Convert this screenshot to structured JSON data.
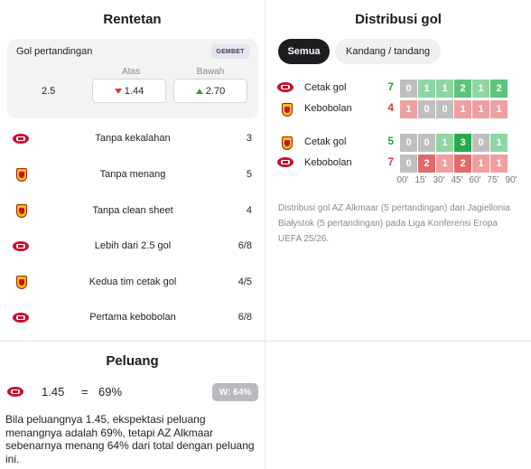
{
  "streaks": {
    "title": "Rentetan",
    "odds": {
      "label": "Gol pertandingan",
      "bookmaker": "GEMBET",
      "line": "2.5",
      "over_label": "Atas",
      "under_label": "Bawah",
      "over_value": "1.44",
      "under_value": "2.70",
      "over_trend": "down",
      "under_trend": "up"
    },
    "items": [
      {
        "team": "AZ Alkmaar",
        "label": "Tanpa kekalahan",
        "value": "3"
      },
      {
        "team": "Jagiellonia Białystok",
        "label": "Tanpa menang",
        "value": "5"
      },
      {
        "team": "Jagiellonia Białystok",
        "label": "Tanpa clean sheet",
        "value": "4"
      },
      {
        "team": "AZ Alkmaar",
        "label": "Lebih dari 2.5 gol",
        "value": "6/8"
      },
      {
        "team": "Jagiellonia Białystok",
        "label": "Kedua tim cetak gol",
        "value": "4/5"
      },
      {
        "team": "AZ Alkmaar",
        "label": "Pertama kebobolan",
        "value": "6/8"
      }
    ]
  },
  "distribution": {
    "title": "Distribusi gol",
    "tabs": [
      {
        "label": "Semua",
        "active": true
      },
      {
        "label": "Kandang / tandang",
        "active": false
      }
    ],
    "groups": [
      {
        "team": "AZ Alkmaar",
        "rows": [
          {
            "label": "Cetak gol",
            "total": "7",
            "cells": [
              0,
              1,
              1,
              2,
              1,
              2
            ],
            "kind": "scored"
          },
          {
            "label": "Kebobolan",
            "total": "4",
            "cells": [
              1,
              0,
              0,
              1,
              1,
              1
            ],
            "kind": "conceded"
          }
        ]
      },
      {
        "team": "Jagiellonia Białystok",
        "rows": [
          {
            "label": "Cetak gol",
            "total": "5",
            "cells": [
              0,
              0,
              1,
              3,
              0,
              1
            ],
            "kind": "scored"
          },
          {
            "label": "Kebobolan",
            "total": "7",
            "cells": [
              0,
              2,
              1,
              2,
              1,
              1
            ],
            "kind": "conceded"
          }
        ]
      }
    ],
    "time_labels": [
      "00'",
      "15'",
      "30'",
      "45'",
      "60'",
      "75'",
      "90'"
    ],
    "description": "Distribusi gol AZ Alkmaar (5 pertandingan) dan Jagiellonia Białystok (5 pertandingan) pada Liga Konferensi Eropa UEFA 25/26.",
    "colors": {
      "scored": "#2ba34a",
      "conceded": "#d63b3b",
      "zero": "#bfbfbf"
    }
  },
  "chance": {
    "title": "Peluang",
    "team": "AZ Alkmaar",
    "odds": "1.45",
    "equals": "=",
    "percent": "69%",
    "badge": "W: 64%",
    "description": "Bila peluangnya 1.45, ekspektasi peluang menangnya adalah 69%, tetapi AZ Alkmaar sebenarnya menang 64% dari total dengan peluang ini."
  }
}
